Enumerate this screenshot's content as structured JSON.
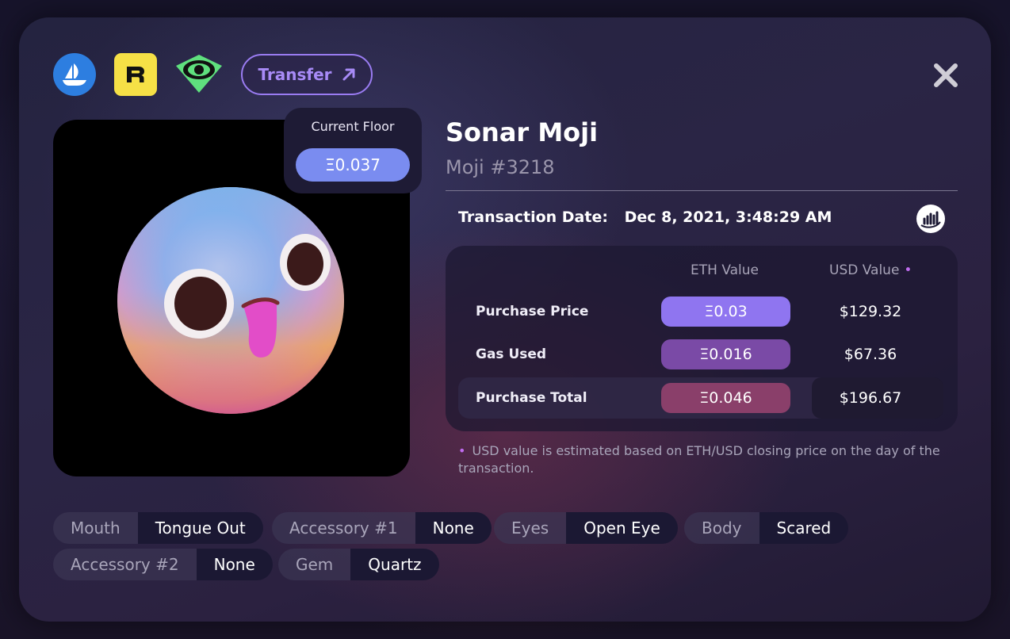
{
  "header": {
    "icons": [
      "opensea-icon",
      "rarible-icon",
      "eye-icon"
    ],
    "transfer_label": "Transfer",
    "close_icon": "close-icon"
  },
  "floor": {
    "label": "Current Floor",
    "value": "Ξ0.037"
  },
  "nft": {
    "collection": "Sonar Moji",
    "name": "Moji #3218"
  },
  "transaction": {
    "label": "Transaction Date:",
    "date": "Dec 8, 2021, 3:48:29 AM"
  },
  "table": {
    "headers": {
      "eth": "ETH Value",
      "usd": "USD Value",
      "usd_marker": "•"
    },
    "rows": [
      {
        "label": "Purchase Price",
        "eth": "Ξ0.03",
        "usd": "$129.32"
      },
      {
        "label": "Gas Used",
        "eth": "Ξ0.016",
        "usd": "$67.36"
      },
      {
        "label": "Purchase Total",
        "eth": "Ξ0.046",
        "usd": "$196.67"
      }
    ]
  },
  "footnote": {
    "marker": "•",
    "text": "USD value is estimated based on ETH/USD closing price on the day of the transaction."
  },
  "traits": [
    {
      "key": "Mouth",
      "value": "Tongue Out"
    },
    {
      "key": "Accessory #1",
      "value": "None"
    },
    {
      "key": "Eyes",
      "value": "Open Eye"
    },
    {
      "key": "Body",
      "value": "Scared"
    },
    {
      "key": "Accessory #2",
      "value": "None"
    },
    {
      "key": "Gem",
      "value": "Quartz"
    }
  ],
  "colors": {
    "accent": "#9a7cf2",
    "floor_pill": "#7a8cf0",
    "pill_price": "#8f75f0",
    "pill_gas": "#7a4aa6",
    "pill_total": "#8a3f6a"
  }
}
